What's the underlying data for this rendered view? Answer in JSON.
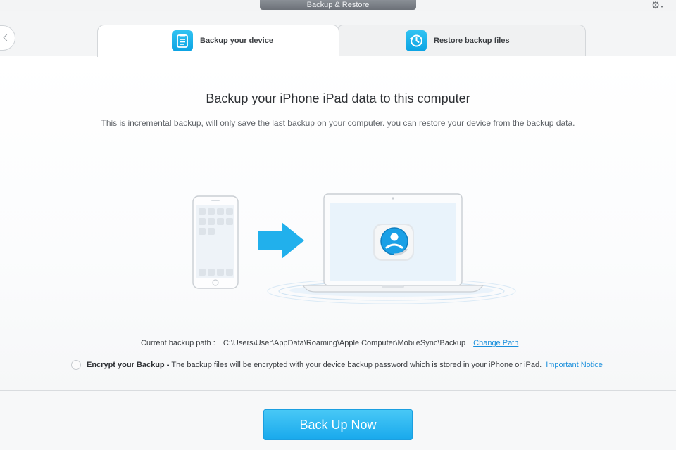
{
  "window": {
    "title": "Backup & Restore",
    "settings_icon": "gear-icon"
  },
  "tabs": [
    {
      "label": "Backup your device",
      "icon": "backup-document-icon",
      "active": true
    },
    {
      "label": "Restore backup files",
      "icon": "restore-clock-icon",
      "active": false
    }
  ],
  "main": {
    "headline": "Backup your iPhone iPad data to this computer",
    "subline": "This is incremental backup, will only save the last backup on your computer. you can restore your device from the backup data."
  },
  "backup_path": {
    "label": "Current backup path :",
    "value": "C:\\Users\\User\\AppData\\Roaming\\Apple Computer\\MobileSync\\Backup",
    "change_link": "Change Path"
  },
  "encrypt": {
    "checked": false,
    "label": "Encrypt your Backup -",
    "description": "The backup files will be encrypted with your device backup password which is stored in your iPhone or iPad.",
    "notice_link": "Important Notice"
  },
  "actions": {
    "back_up_now": "Back Up Now"
  },
  "colors": {
    "accent": "#1aa8ec",
    "link": "#1a8fdc",
    "tab_icon": "#12aee8"
  }
}
